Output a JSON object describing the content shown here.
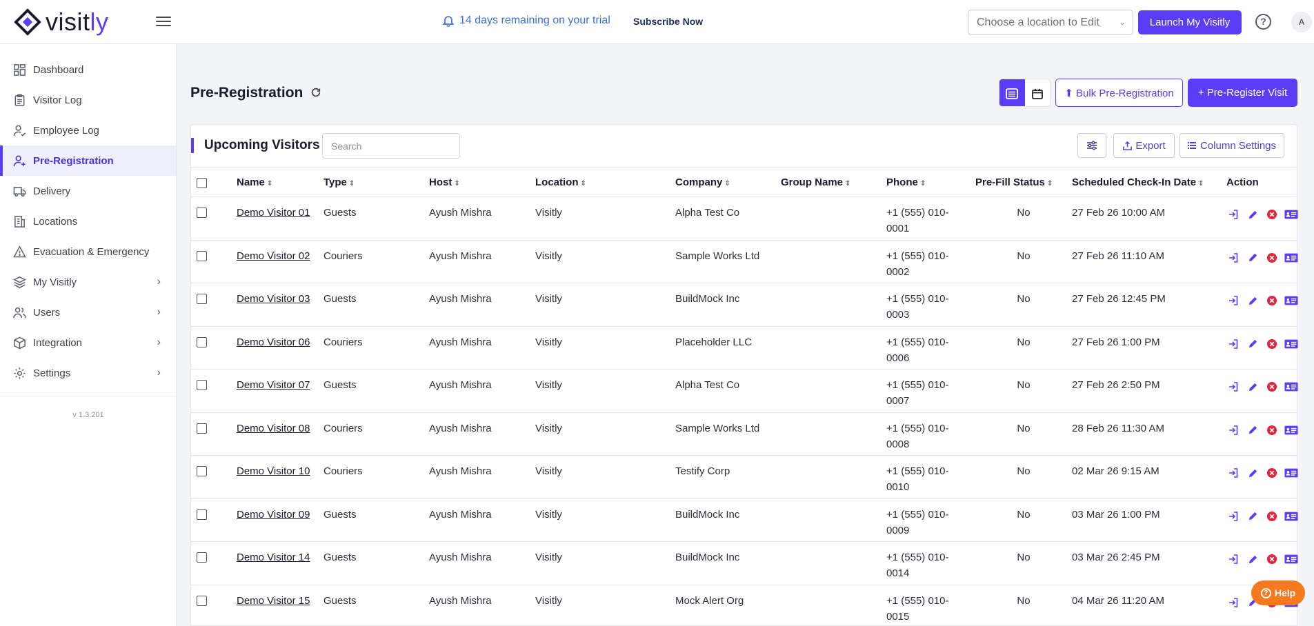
{
  "brand": {
    "name_prefix": "visit",
    "name_suffix": "ly"
  },
  "topbar": {
    "trial_text": "14 days remaining on your trial",
    "subscribe": "Subscribe Now",
    "location_placeholder": "Choose a location to Edit",
    "launch": "Launch My Visitly",
    "avatar_initial": "A"
  },
  "sidebar": {
    "items": [
      {
        "label": "Dashboard",
        "icon": "dashboard-icon"
      },
      {
        "label": "Visitor Log",
        "icon": "clipboard-icon"
      },
      {
        "label": "Employee Log",
        "icon": "user-check-icon"
      },
      {
        "label": "Pre-Registration",
        "icon": "user-plus-icon",
        "active": true
      },
      {
        "label": "Delivery",
        "icon": "truck-icon"
      },
      {
        "label": "Locations",
        "icon": "building-icon"
      },
      {
        "label": "Evacuation & Emergency",
        "icon": "warning-icon"
      },
      {
        "label": "My Visitly",
        "icon": "layers-icon",
        "expandable": true
      },
      {
        "label": "Users",
        "icon": "users-icon",
        "expandable": true
      },
      {
        "label": "Integration",
        "icon": "box-icon",
        "expandable": true
      },
      {
        "label": "Settings",
        "icon": "gear-icon",
        "expandable": true
      }
    ],
    "version": "v 1.3.201"
  },
  "page": {
    "title": "Pre-Registration",
    "bulk": "Bulk Pre-Registration",
    "preregister": "Pre-Register Visit"
  },
  "panel": {
    "title": "Upcoming Visitors",
    "search_placeholder": "Search",
    "export": "Export",
    "column_settings": "Column Settings"
  },
  "table": {
    "columns": [
      "Name",
      "Type",
      "Host",
      "Location",
      "Company",
      "Group Name",
      "Phone",
      "Pre-Fill Status",
      "Scheduled Check-In Date",
      "Action"
    ],
    "rows": [
      {
        "name": "Demo Visitor 01",
        "type": "Guests",
        "host": "Ayush Mishra",
        "location": "Visitly",
        "company": "Alpha Test Co",
        "group": "",
        "phone1": "+1 (555) 010-",
        "phone2": "0001",
        "prefill": "No",
        "date": "27 Feb 26 10:00 AM"
      },
      {
        "name": "Demo Visitor 02",
        "type": "Couriers",
        "host": "Ayush Mishra",
        "location": "Visitly",
        "company": "Sample Works Ltd",
        "group": "",
        "phone1": "+1 (555) 010-",
        "phone2": "0002",
        "prefill": "No",
        "date": "27 Feb 26 11:10 AM"
      },
      {
        "name": "Demo Visitor 03",
        "type": "Guests",
        "host": "Ayush Mishra",
        "location": "Visitly",
        "company": "BuildMock Inc",
        "group": "",
        "phone1": "+1 (555) 010-",
        "phone2": "0003",
        "prefill": "No",
        "date": "27 Feb 26 12:45 PM"
      },
      {
        "name": "Demo Visitor 06",
        "type": "Couriers",
        "host": "Ayush Mishra",
        "location": "Visitly",
        "company": "Placeholder LLC",
        "group": "",
        "phone1": "+1 (555) 010-",
        "phone2": "0006",
        "prefill": "No",
        "date": "27 Feb 26 1:00 PM"
      },
      {
        "name": "Demo Visitor 07",
        "type": "Guests",
        "host": "Ayush Mishra",
        "location": "Visitly",
        "company": "Alpha Test Co",
        "group": "",
        "phone1": "+1 (555) 010-",
        "phone2": "0007",
        "prefill": "No",
        "date": "27 Feb 26 2:50 PM"
      },
      {
        "name": "Demo Visitor 08",
        "type": "Couriers",
        "host": "Ayush Mishra",
        "location": "Visitly",
        "company": "Sample Works Ltd",
        "group": "",
        "phone1": "+1 (555) 010-",
        "phone2": "0008",
        "prefill": "No",
        "date": "28 Feb 26 11:30 AM"
      },
      {
        "name": "Demo Visitor 10",
        "type": "Couriers",
        "host": "Ayush Mishra",
        "location": "Visitly",
        "company": "Testify Corp",
        "group": "",
        "phone1": "+1 (555) 010-",
        "phone2": "0010",
        "prefill": "No",
        "date": "02 Mar 26 9:15 AM"
      },
      {
        "name": "Demo Visitor 09",
        "type": "Guests",
        "host": "Ayush Mishra",
        "location": "Visitly",
        "company": "BuildMock Inc",
        "group": "",
        "phone1": "+1 (555) 010-",
        "phone2": "0009",
        "prefill": "No",
        "date": "03 Mar 26 1:00 PM"
      },
      {
        "name": "Demo Visitor 14",
        "type": "Guests",
        "host": "Ayush Mishra",
        "location": "Visitly",
        "company": "BuildMock Inc",
        "group": "",
        "phone1": "+1 (555) 010-",
        "phone2": "0014",
        "prefill": "No",
        "date": "03 Mar 26 2:45 PM"
      },
      {
        "name": "Demo Visitor 15",
        "type": "Guests",
        "host": "Ayush Mishra",
        "location": "Visitly",
        "company": "Mock Alert Org",
        "group": "",
        "phone1": "+1 (555) 010-",
        "phone2": "0015",
        "prefill": "No",
        "date": "04 Mar 26 11:20 AM"
      }
    ]
  },
  "help_fab": "Help",
  "colors": {
    "accent": "#5b3df5",
    "danger": "#e5243b",
    "help": "#f4791f",
    "trial": "#3b6fd8"
  }
}
